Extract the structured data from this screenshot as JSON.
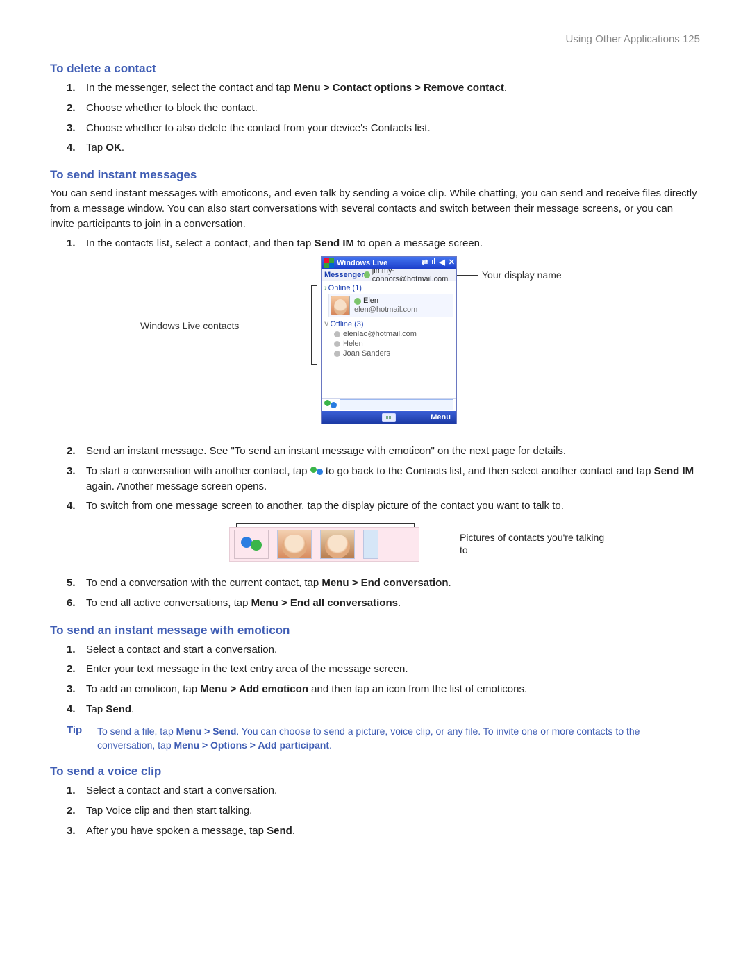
{
  "header": {
    "running_head": "Using Other Applications  125"
  },
  "s1": {
    "heading": "To delete a contact",
    "items": {
      "i1_pre": "In the messenger, select the contact and tap ",
      "i1_bold": "Menu > Contact options > Remove contact",
      "i1_post": ".",
      "i2": "Choose whether to block the contact.",
      "i3": "Choose whether to also delete the contact from your device's Contacts list.",
      "i4_pre": "Tap ",
      "i4_bold": "OK",
      "i4_post": "."
    }
  },
  "s2": {
    "heading": "To send instant messages",
    "intro": "You can send instant messages with emoticons, and even talk by sending a voice clip. While chatting, you can send and receive files directly from a message window. You can also start conversations with several contacts and switch between their message screens, or you can invite participants to join in a conversation.",
    "items": {
      "i1_pre": "In the contacts list, select a contact, and then tap ",
      "i1_bold": "Send IM",
      "i1_post": " to open a message screen.",
      "i2": "Send an instant message. See \"To send an instant message with emoticon\" on the next page for details.",
      "i3_pre": "To start a conversation with another contact, tap ",
      "i3_mid": " to go back to the Contacts list, and then select another contact and tap ",
      "i3_bold": "Send IM",
      "i3_post": " again. Another message screen opens.",
      "i4": "To switch from one message screen to another, tap the display picture of the contact you want to talk to.",
      "i5_pre": "To end a conversation with the current contact, tap ",
      "i5_bold": "Menu > End conversation",
      "i5_post": ".",
      "i6_pre": "To end all active conversations, tap ",
      "i6_bold": "Menu > End all conversations",
      "i6_post": "."
    },
    "callouts": {
      "contacts_label": "Windows Live contacts",
      "display_name_label": "Your display name",
      "strip_label": "Pictures of contacts you're talking to"
    },
    "screenshot": {
      "title": "Windows Live",
      "tab": "Messenger",
      "signed_in_as": "jimmy-connors@hotmail.com",
      "online_group": "Online (1)",
      "online_contact_name": "Elen",
      "online_contact_email": "elen@hotmail.com",
      "offline_group": "Offline (3)",
      "offline": {
        "c1": "elenlao@hotmail.com",
        "c2": "Helen",
        "c3": "Joan Sanders"
      },
      "softkey_right": "Menu"
    }
  },
  "s3": {
    "heading": "To send an instant message with emoticon",
    "items": {
      "i1": "Select a contact and start a conversation.",
      "i2": "Enter your text message in the text entry area of the message screen.",
      "i3_pre": "To add an emoticon, tap ",
      "i3_bold": "Menu > Add emoticon",
      "i3_post": " and then tap an icon from the list of emoticons.",
      "i4_pre": "Tap ",
      "i4_bold": "Send",
      "i4_post": "."
    },
    "tip": {
      "label": "Tip",
      "body_pre": "To send a file, tap ",
      "body_b1": "Menu > Send",
      "body_mid": ". You can choose to send a picture, voice clip, or any file. To invite one or more contacts to the conversation, tap ",
      "body_b2": "Menu > Options > Add participant",
      "body_post": "."
    }
  },
  "s4": {
    "heading": "To send a voice clip",
    "items": {
      "i1": "Select a contact and start a conversation.",
      "i2": "Tap Voice clip and then start talking.",
      "i3_pre": "After you have spoken a message, tap ",
      "i3_bold": "Send",
      "i3_post": "."
    }
  }
}
